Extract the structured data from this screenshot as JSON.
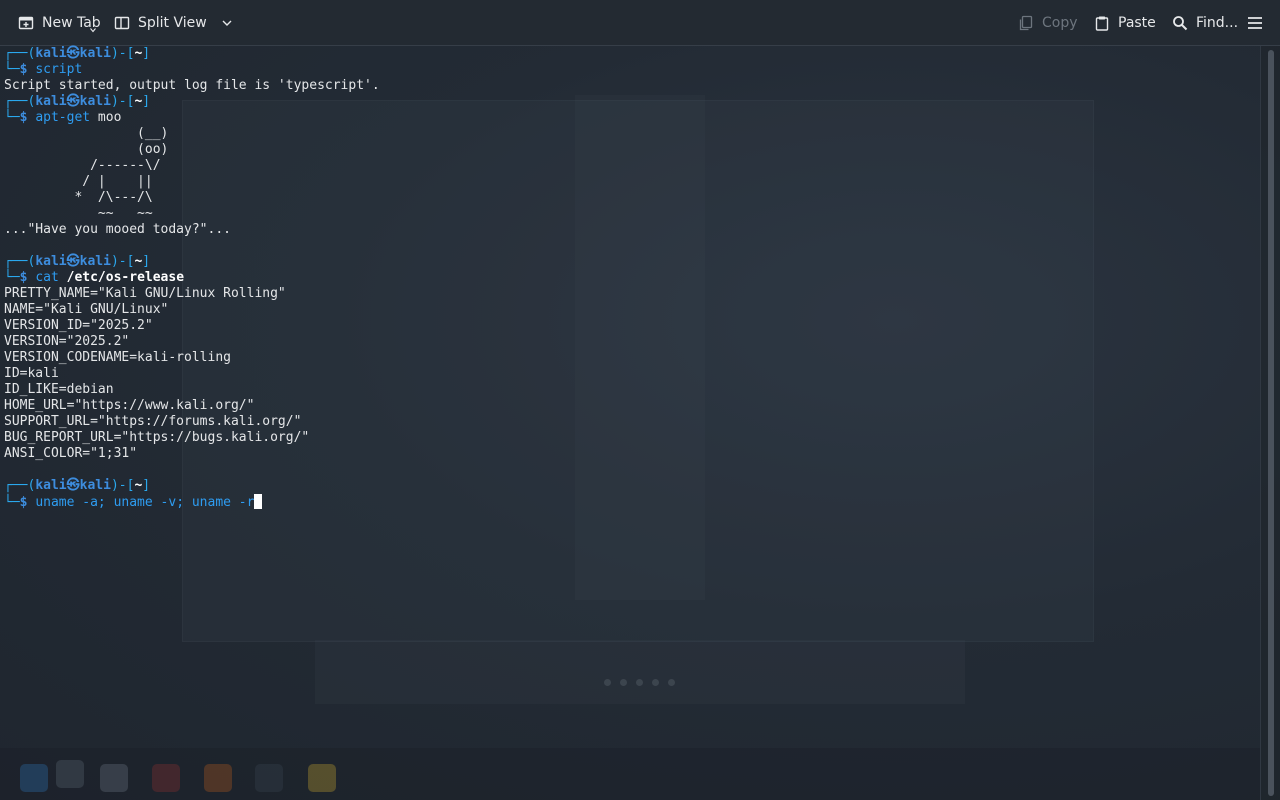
{
  "toolbar": {
    "new_tab_label": "New Tab",
    "split_view_label": "Split View",
    "copy_label": "Copy",
    "paste_label": "Paste",
    "find_label": "Find..."
  },
  "terminal": {
    "prompt": {
      "user": "kali",
      "at_symbol": "㉿",
      "host": "kali",
      "dir": "~",
      "symbol": "$"
    },
    "cmd1": "script",
    "out1": "Script started, output log file is 'typescript'.",
    "cmd2": "apt-get",
    "cmd2_arg": " moo",
    "cow": [
      "                 (__)",
      "                 (oo)",
      "           /------\\/",
      "          / |    ||",
      "         *  /\\---/\\",
      "            ~~   ~~",
      "...\"Have you mooed today?\"..."
    ],
    "cmd3": "cat",
    "cmd3_arg": "/etc/os-release",
    "os_release": [
      "PRETTY_NAME=\"Kali GNU/Linux Rolling\"",
      "NAME=\"Kali GNU/Linux\"",
      "VERSION_ID=\"2025.2\"",
      "VERSION=\"2025.2\"",
      "VERSION_CODENAME=kali-rolling",
      "ID=kali",
      "ID_LIKE=debian",
      "HOME_URL=\"https://www.kali.org/\"",
      "SUPPORT_URL=\"https://forums.kali.org/\"",
      "BUG_REPORT_URL=\"https://bugs.kali.org/\"",
      "ANSI_COLOR=\"1;31\""
    ],
    "cmd4_typed": "uname -a; uname -v; uname -",
    "cmd4_cursor_char": "r"
  },
  "colors": {
    "prompt_blue": "#3d8dde",
    "command_blue": "#2e9cf0",
    "text": "#e4e6e8",
    "background": "#222a33"
  },
  "icons": {
    "new_tab": "new-tab-icon",
    "split_view": "split-view-icon",
    "dropdown": "chevron-down-icon",
    "copy": "copy-icon",
    "paste": "paste-icon",
    "find": "search-icon",
    "menu": "hamburger-menu-icon"
  }
}
